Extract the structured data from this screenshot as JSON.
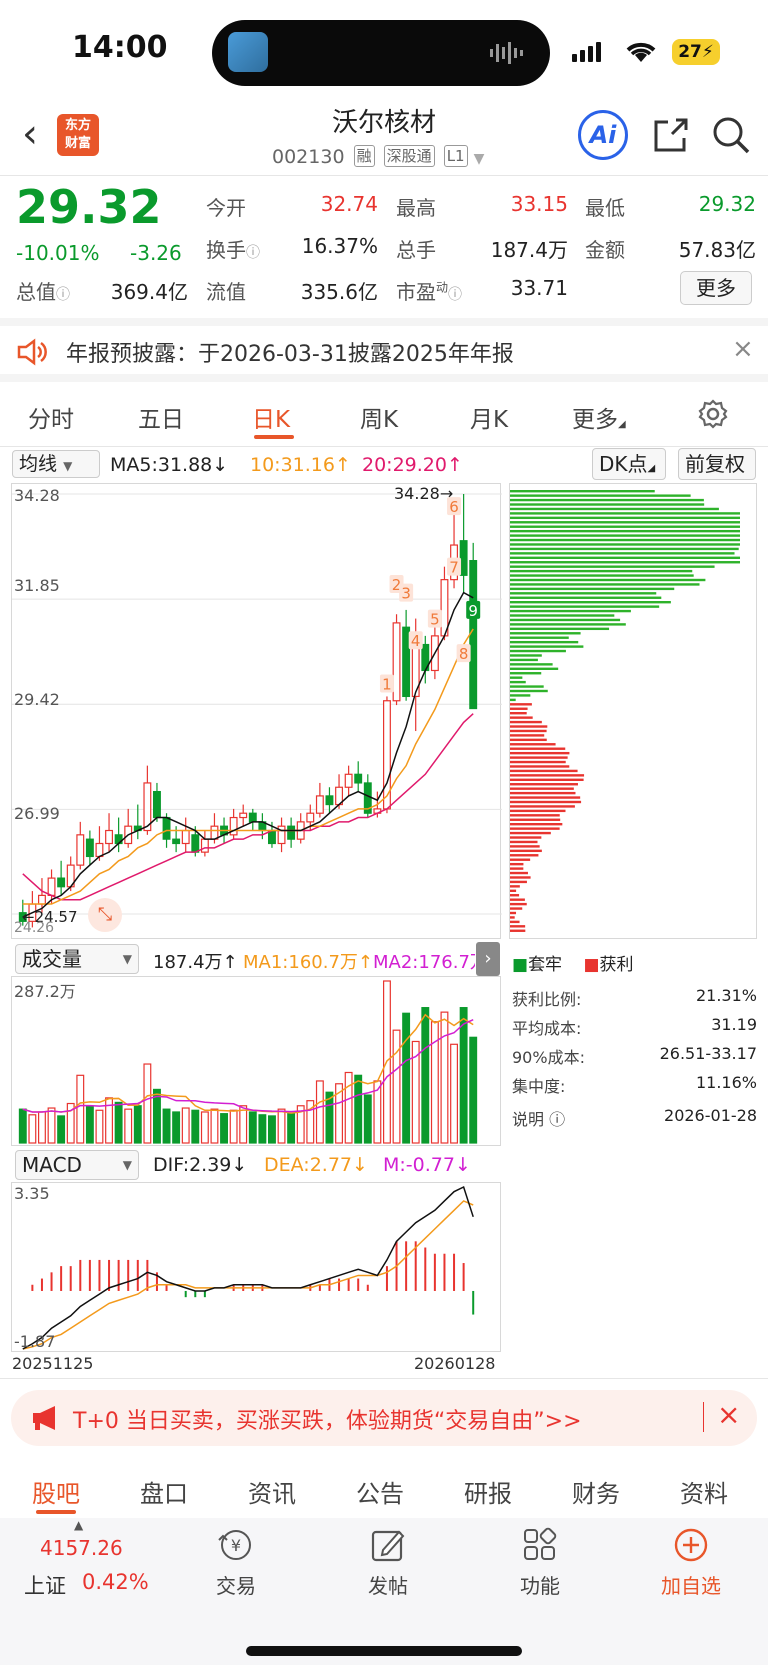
{
  "status": {
    "time": "14:00",
    "battery": "27"
  },
  "header": {
    "title": "沃尔核材",
    "code": "002130",
    "tags": [
      "融",
      "深股通",
      "L1"
    ],
    "logo_text": [
      "东方",
      "财富"
    ],
    "ai_label": "Ai"
  },
  "quote": {
    "price": "29.32",
    "change_pct": "-10.01%",
    "change": "-3.26",
    "open_label": "今开",
    "open": "32.74",
    "high_label": "最高",
    "high": "33.15",
    "low_label": "最低",
    "low": "29.32",
    "turnover_label": "换手",
    "turnover": "16.37%",
    "volume_label": "总手",
    "volume": "187.4万",
    "amount_label": "金额",
    "amount": "57.83亿",
    "mktcap_label": "总值",
    "mktcap": "369.4亿",
    "float_label": "流值",
    "float": "335.6亿",
    "pe_label": "市盈",
    "pe_sup": "动",
    "pe": "33.71",
    "more_label": "更多"
  },
  "notice": {
    "text": "年报预披露：于2026-03-31披露2025年年报"
  },
  "period_tabs": [
    {
      "label": "分时"
    },
    {
      "label": "五日"
    },
    {
      "label": "日K",
      "active": true
    },
    {
      "label": "周K"
    },
    {
      "label": "月K"
    },
    {
      "label": "更多"
    }
  ],
  "kline_header": {
    "selector": "均线",
    "ma5": "MA5:31.88",
    "ma10": "10:31.16",
    "ma20": "20:29.20",
    "dk_label": "DK点",
    "adjust_label": "前复权"
  },
  "kline_axis": [
    "34.28",
    "31.85",
    "29.42",
    "26.99"
  ],
  "kline_annotations": {
    "high": "34.28",
    "low_partial": "24.57",
    "low2": "24.26"
  },
  "kline_markers": [
    "1",
    "2",
    "3",
    "4",
    "5",
    "6",
    "7",
    "8",
    "9"
  ],
  "volume_header": {
    "selector": "成交量",
    "vol": "187.4万",
    "ma1": "MA1:160.7万",
    "ma2": "MA2:176.7万",
    "axis_top": "287.2万"
  },
  "macd_header": {
    "selector": "MACD",
    "dif": "DIF:2.39",
    "dea": "DEA:2.77",
    "m": "M:-0.77",
    "axis_top": "3.35",
    "axis_bottom": "-1.87"
  },
  "date_range": {
    "start": "20251125",
    "end": "20260128"
  },
  "chip_distribution": {
    "legend_trapped": "套牢",
    "legend_profit": "获利",
    "rows": [
      {
        "label": "获利比例:",
        "value": "21.31%"
      },
      {
        "label": "平均成本:",
        "value": "31.19"
      },
      {
        "label": "90%成本:",
        "value": "26.51-33.17"
      },
      {
        "label": "集中度:",
        "value": "11.16%"
      }
    ],
    "note_label": "说明",
    "note_date": "2026-01-28"
  },
  "chart_data": {
    "type": "candlestick",
    "ylim": [
      24.2,
      34.28
    ],
    "candles": [
      {
        "o": 24.6,
        "c": 24.4,
        "h": 24.9,
        "l": 24.3
      },
      {
        "o": 24.4,
        "c": 24.8,
        "h": 25.1,
        "l": 24.26
      },
      {
        "o": 24.8,
        "c": 25.0,
        "h": 25.4,
        "l": 24.6
      },
      {
        "o": 25.0,
        "c": 25.4,
        "h": 25.6,
        "l": 24.8
      },
      {
        "o": 25.4,
        "c": 25.2,
        "h": 25.8,
        "l": 25.0
      },
      {
        "o": 25.2,
        "c": 25.7,
        "h": 25.9,
        "l": 25.1
      },
      {
        "o": 25.7,
        "c": 26.4,
        "h": 26.7,
        "l": 25.6
      },
      {
        "o": 26.3,
        "c": 25.9,
        "h": 26.5,
        "l": 25.7
      },
      {
        "o": 25.9,
        "c": 26.2,
        "h": 26.6,
        "l": 25.8
      },
      {
        "o": 26.2,
        "c": 26.5,
        "h": 26.9,
        "l": 26.0
      },
      {
        "o": 26.4,
        "c": 26.2,
        "h": 26.8,
        "l": 26.0
      },
      {
        "o": 26.2,
        "c": 26.6,
        "h": 27.0,
        "l": 26.1
      },
      {
        "o": 26.6,
        "c": 26.5,
        "h": 27.1,
        "l": 26.3
      },
      {
        "o": 26.5,
        "c": 27.6,
        "h": 28.0,
        "l": 26.4
      },
      {
        "o": 27.4,
        "c": 26.8,
        "h": 27.6,
        "l": 26.7
      },
      {
        "o": 26.8,
        "c": 26.3,
        "h": 26.9,
        "l": 26.1
      },
      {
        "o": 26.3,
        "c": 26.2,
        "h": 26.6,
        "l": 26.0
      },
      {
        "o": 26.2,
        "c": 26.5,
        "h": 26.8,
        "l": 26.0
      },
      {
        "o": 26.4,
        "c": 26.0,
        "h": 26.6,
        "l": 25.9
      },
      {
        "o": 26.0,
        "c": 26.3,
        "h": 26.5,
        "l": 25.9
      },
      {
        "o": 26.3,
        "c": 26.6,
        "h": 26.9,
        "l": 26.2
      },
      {
        "o": 26.6,
        "c": 26.4,
        "h": 26.8,
        "l": 26.2
      },
      {
        "o": 26.4,
        "c": 26.8,
        "h": 27.0,
        "l": 26.3
      },
      {
        "o": 26.8,
        "c": 26.9,
        "h": 27.1,
        "l": 26.6
      },
      {
        "o": 26.9,
        "c": 26.7,
        "h": 27.0,
        "l": 26.5
      },
      {
        "o": 26.7,
        "c": 26.5,
        "h": 26.9,
        "l": 26.3
      },
      {
        "o": 26.5,
        "c": 26.2,
        "h": 26.7,
        "l": 26.1
      },
      {
        "o": 26.2,
        "c": 26.6,
        "h": 26.8,
        "l": 26.0
      },
      {
        "o": 26.6,
        "c": 26.3,
        "h": 26.8,
        "l": 26.1
      },
      {
        "o": 26.3,
        "c": 26.7,
        "h": 26.9,
        "l": 26.2
      },
      {
        "o": 26.7,
        "c": 26.9,
        "h": 27.1,
        "l": 26.5
      },
      {
        "o": 26.9,
        "c": 27.3,
        "h": 27.6,
        "l": 26.8
      },
      {
        "o": 27.3,
        "c": 27.1,
        "h": 27.5,
        "l": 26.9
      },
      {
        "o": 27.1,
        "c": 27.5,
        "h": 27.8,
        "l": 27.0
      },
      {
        "o": 27.5,
        "c": 27.8,
        "h": 28.0,
        "l": 27.3
      },
      {
        "o": 27.8,
        "c": 27.6,
        "h": 28.1,
        "l": 27.4
      },
      {
        "o": 27.6,
        "c": 26.9,
        "h": 27.8,
        "l": 26.8
      },
      {
        "o": 26.9,
        "c": 27.0,
        "h": 27.4,
        "l": 26.8
      },
      {
        "o": 27.0,
        "c": 29.5,
        "h": 29.6,
        "l": 26.9
      },
      {
        "o": 29.5,
        "c": 31.3,
        "h": 31.5,
        "l": 29.4
      },
      {
        "o": 31.2,
        "c": 29.6,
        "h": 31.6,
        "l": 29.5
      },
      {
        "o": 29.6,
        "c": 30.9,
        "h": 31.4,
        "l": 28.8
      },
      {
        "o": 30.8,
        "c": 30.2,
        "h": 31.0,
        "l": 29.9
      },
      {
        "o": 30.2,
        "c": 31.0,
        "h": 31.4,
        "l": 30.0
      },
      {
        "o": 31.0,
        "c": 32.3,
        "h": 32.6,
        "l": 30.9
      },
      {
        "o": 32.3,
        "c": 33.1,
        "h": 34.0,
        "l": 32.1
      },
      {
        "o": 33.2,
        "c": 32.4,
        "h": 34.28,
        "l": 32.0
      },
      {
        "o": 32.74,
        "c": 29.32,
        "h": 33.15,
        "l": 29.32
      }
    ],
    "ma5": [
      24.5,
      24.6,
      24.7,
      24.9,
      25.0,
      25.2,
      25.5,
      25.7,
      25.9,
      26.0,
      26.2,
      26.4,
      26.5,
      26.6,
      26.8,
      26.8,
      26.7,
      26.6,
      26.5,
      26.3,
      26.3,
      26.4,
      26.5,
      26.6,
      26.7,
      26.7,
      26.6,
      26.5,
      26.5,
      26.5,
      26.6,
      26.7,
      26.9,
      27.1,
      27.3,
      27.4,
      27.3,
      27.2,
      27.6,
      28.3,
      28.9,
      29.7,
      30.2,
      30.6,
      31.0,
      31.6,
      32.0,
      31.88
    ],
    "ma10": [
      24.8,
      24.8,
      24.8,
      24.8,
      24.9,
      25.0,
      25.1,
      25.3,
      25.5,
      25.6,
      25.8,
      25.9,
      26.1,
      26.2,
      26.4,
      26.5,
      26.5,
      26.5,
      26.5,
      26.5,
      26.5,
      26.5,
      26.5,
      26.5,
      26.5,
      26.5,
      26.5,
      26.5,
      26.5,
      26.5,
      26.6,
      26.6,
      26.7,
      26.8,
      26.9,
      27.0,
      27.0,
      27.1,
      27.3,
      27.7,
      28.0,
      28.5,
      28.9,
      29.3,
      29.8,
      30.3,
      30.8,
      31.16
    ],
    "ma20": [
      25.5,
      25.3,
      25.1,
      25.0,
      24.9,
      24.9,
      24.9,
      25.0,
      25.1,
      25.2,
      25.3,
      25.4,
      25.5,
      25.6,
      25.7,
      25.8,
      25.9,
      26.0,
      26.0,
      26.1,
      26.1,
      26.2,
      26.3,
      26.3,
      26.4,
      26.4,
      26.5,
      26.5,
      26.5,
      26.5,
      26.5,
      26.6,
      26.6,
      26.7,
      26.7,
      26.8,
      26.8,
      26.9,
      27.0,
      27.2,
      27.4,
      27.6,
      27.8,
      28.1,
      28.4,
      28.7,
      29.0,
      29.2
    ],
    "volume": [
      60,
      50,
      55,
      62,
      48,
      70,
      120,
      65,
      58,
      80,
      72,
      60,
      66,
      140,
      95,
      60,
      55,
      62,
      58,
      55,
      60,
      52,
      58,
      66,
      55,
      50,
      48,
      60,
      52,
      66,
      75,
      110,
      90,
      105,
      125,
      120,
      85,
      110,
      287.2,
      200,
      230,
      180,
      240,
      215,
      232,
      175,
      240,
      187.4
    ],
    "volume_ylim": [
      0,
      287.2
    ],
    "macd_dif": [
      -1.87,
      -1.7,
      -1.5,
      -1.2,
      -1.0,
      -0.8,
      -0.5,
      -0.3,
      -0.1,
      0.1,
      0.2,
      0.3,
      0.4,
      0.6,
      0.5,
      0.3,
      0.2,
      0.1,
      0.0,
      0.0,
      0.1,
      0.1,
      0.2,
      0.2,
      0.2,
      0.2,
      0.1,
      0.1,
      0.1,
      0.1,
      0.2,
      0.3,
      0.4,
      0.5,
      0.6,
      0.7,
      0.6,
      0.5,
      1.0,
      1.6,
      1.9,
      2.2,
      2.4,
      2.6,
      2.9,
      3.2,
      3.35,
      2.39
    ],
    "macd_dea": [
      -1.87,
      -1.8,
      -1.7,
      -1.5,
      -1.4,
      -1.2,
      -1.0,
      -0.8,
      -0.6,
      -0.4,
      -0.3,
      -0.2,
      -0.1,
      0.1,
      0.2,
      0.2,
      0.2,
      0.2,
      0.1,
      0.1,
      0.1,
      0.1,
      0.1,
      0.1,
      0.1,
      0.1,
      0.1,
      0.1,
      0.1,
      0.1,
      0.1,
      0.2,
      0.2,
      0.3,
      0.4,
      0.5,
      0.5,
      0.5,
      0.6,
      0.8,
      1.1,
      1.4,
      1.7,
      2.0,
      2.3,
      2.6,
      2.9,
      2.77
    ],
    "macd_ylim": [
      -1.87,
      3.35
    ]
  }
}
